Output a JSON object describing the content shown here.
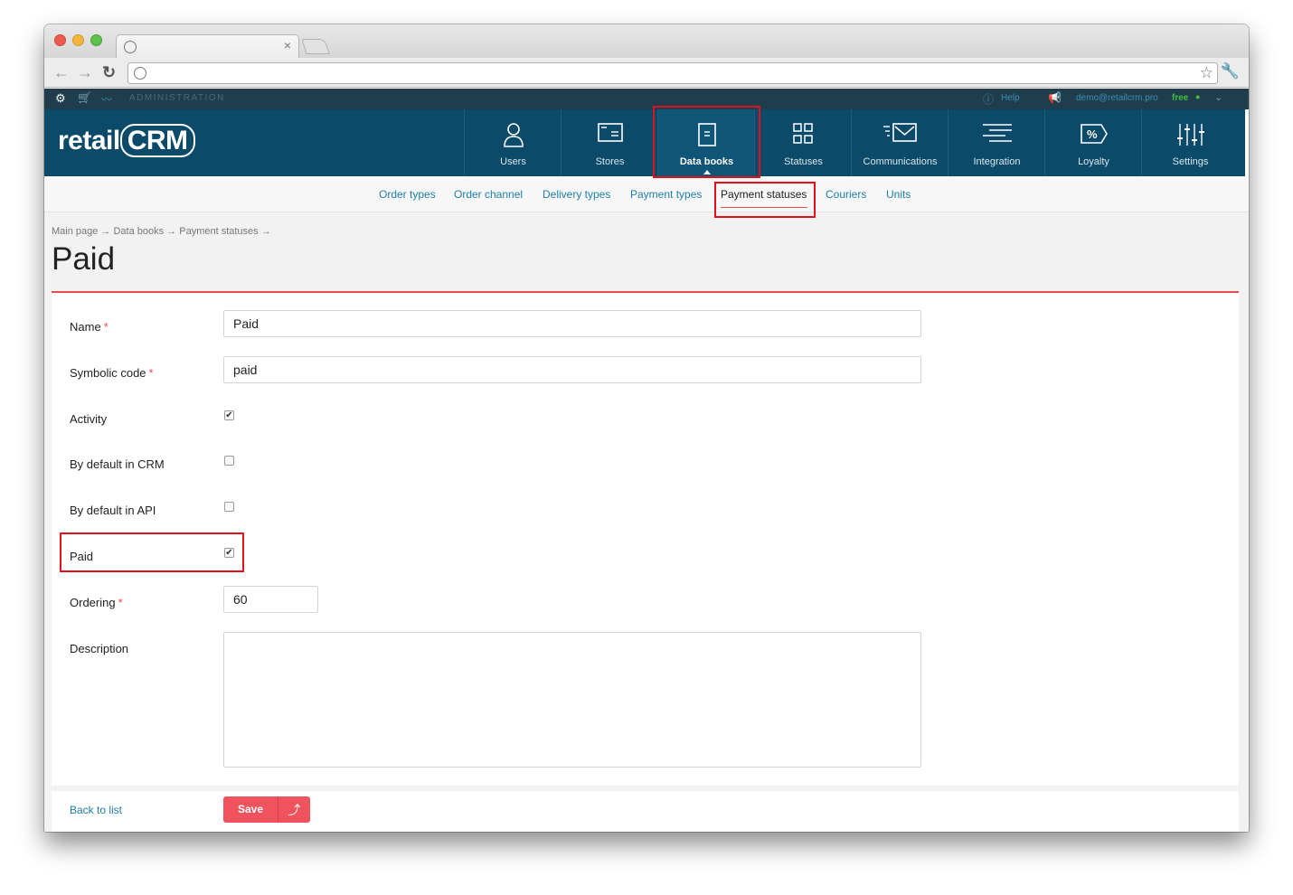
{
  "topbar": {
    "section": "ADMINISTRATION",
    "help": "Help",
    "email": "demo@retailcrm.pro",
    "plan": "free"
  },
  "logo": {
    "part1": "retail",
    "part2": "CRM"
  },
  "nav": [
    {
      "label": "Users",
      "icon": "user-icon"
    },
    {
      "label": "Stores",
      "icon": "store-icon"
    },
    {
      "label": "Data books",
      "icon": "book-icon"
    },
    {
      "label": "Statuses",
      "icon": "grid-icon"
    },
    {
      "label": "Communications",
      "icon": "mail-icon"
    },
    {
      "label": "Integration",
      "icon": "lines-icon"
    },
    {
      "label": "Loyalty",
      "icon": "percent-tag-icon"
    },
    {
      "label": "Settings",
      "icon": "sliders-icon"
    }
  ],
  "subnav": [
    "Order types",
    "Order channel",
    "Delivery types",
    "Payment types",
    "Payment statuses",
    "Couriers",
    "Units"
  ],
  "breadcrumb": "Main page → Data books → Payment statuses →",
  "page_title": "Paid",
  "form": {
    "name_label": "Name",
    "name_value": "Paid",
    "code_label": "Symbolic code",
    "code_value": "paid",
    "activity_label": "Activity",
    "activity_checked": true,
    "default_crm_label": "By default in CRM",
    "default_crm_checked": false,
    "default_api_label": "By default in API",
    "default_api_checked": false,
    "paid_label": "Paid",
    "paid_checked": true,
    "ordering_label": "Ordering",
    "ordering_value": "60",
    "description_label": "Description",
    "description_value": ""
  },
  "footer": {
    "back": "Back to list",
    "save": "Save"
  },
  "colors": {
    "header": "#0b4b69",
    "accent": "#f0525e",
    "link": "#1f7fa8",
    "highlight": "#e1101a"
  }
}
